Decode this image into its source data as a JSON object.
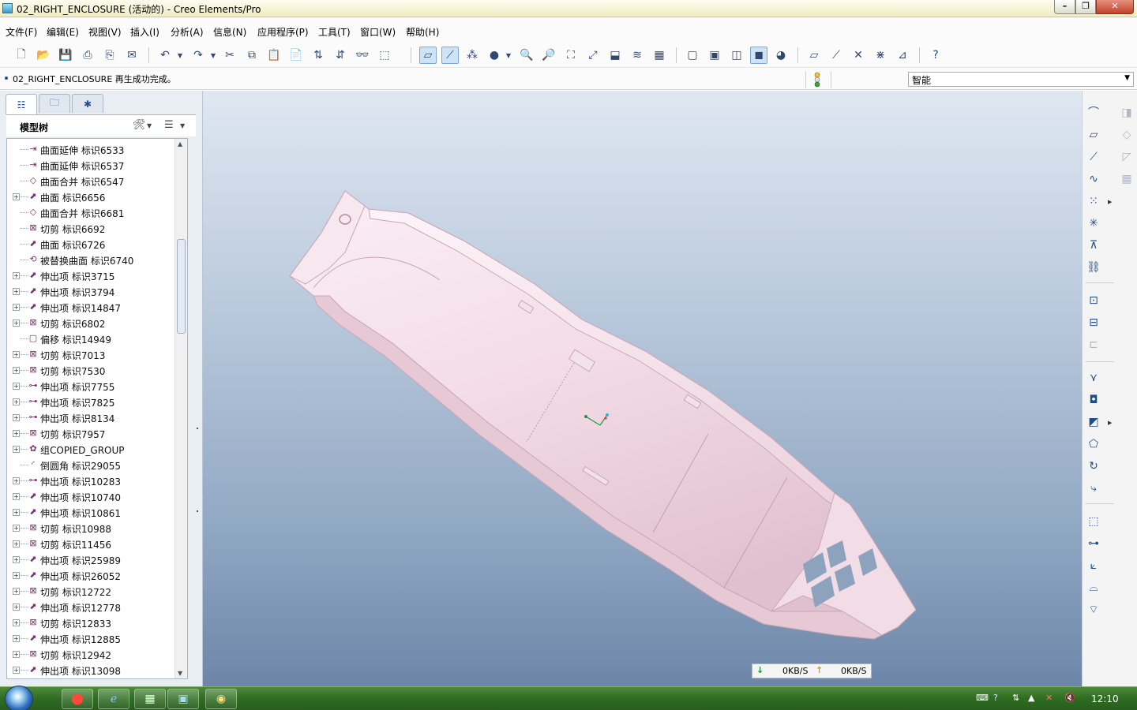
{
  "window": {
    "title": "02_RIGHT_ENCLOSURE (活动的) - Creo Elements/Pro",
    "min": "–",
    "max": "❐",
    "close": "✕"
  },
  "menu": [
    "文件(F)",
    "编辑(E)",
    "视图(V)",
    "插入(I)",
    "分析(A)",
    "信息(N)",
    "应用程序(P)",
    "工具(T)",
    "窗口(W)",
    "帮助(H)"
  ],
  "message": "02_RIGHT_ENCLOSURE 再生成功完成。",
  "filter": {
    "value": "智能"
  },
  "tree": {
    "header": "模型树",
    "items": [
      {
        "label": "曲面延伸 标识6533",
        "expand": false,
        "icon": "extend-icon"
      },
      {
        "label": "曲面延伸 标识6537",
        "expand": false,
        "icon": "extend-icon"
      },
      {
        "label": "曲面合并 标识6547",
        "expand": false,
        "icon": "merge-icon"
      },
      {
        "label": "曲面 标识6656",
        "expand": true,
        "icon": "surface-icon"
      },
      {
        "label": "曲面合并 标识6681",
        "expand": false,
        "icon": "merge-icon"
      },
      {
        "label": "切剪 标识6692",
        "expand": false,
        "icon": "cut-icon"
      },
      {
        "label": "曲面 标识6726",
        "expand": false,
        "icon": "surface-icon"
      },
      {
        "label": "被替换曲面 标识6740",
        "expand": false,
        "icon": "replace-icon"
      },
      {
        "label": "伸出项 标识3715",
        "expand": true,
        "icon": "protrusion-icon"
      },
      {
        "label": "伸出项 标识3794",
        "expand": true,
        "icon": "protrusion-icon"
      },
      {
        "label": "伸出项 标识14847",
        "expand": true,
        "icon": "protrusion-icon"
      },
      {
        "label": "切剪 标识6802",
        "expand": true,
        "icon": "cut-icon"
      },
      {
        "label": "偏移 标识14949",
        "expand": false,
        "icon": "offset-icon"
      },
      {
        "label": "切剪 标识7013",
        "expand": true,
        "icon": "cut-icon"
      },
      {
        "label": "切剪 标识7530",
        "expand": true,
        "icon": "cut-icon"
      },
      {
        "label": "伸出项 标识7755",
        "expand": true,
        "icon": "revolve-icon"
      },
      {
        "label": "伸出项 标识7825",
        "expand": true,
        "icon": "revolve-icon"
      },
      {
        "label": "伸出项 标识8134",
        "expand": true,
        "icon": "revolve-icon"
      },
      {
        "label": "切剪 标识7957",
        "expand": true,
        "icon": "cut-icon"
      },
      {
        "label": "组COPIED_GROUP",
        "expand": true,
        "icon": "group-icon"
      },
      {
        "label": "倒圆角 标识29055",
        "expand": false,
        "icon": "round-icon"
      },
      {
        "label": "伸出项 标识10283",
        "expand": true,
        "icon": "revolve-icon"
      },
      {
        "label": "伸出项 标识10740",
        "expand": true,
        "icon": "protrusion-icon"
      },
      {
        "label": "伸出项 标识10861",
        "expand": true,
        "icon": "protrusion-icon"
      },
      {
        "label": "切剪 标识10988",
        "expand": true,
        "icon": "cut-icon"
      },
      {
        "label": "切剪 标识11456",
        "expand": true,
        "icon": "cut-icon"
      },
      {
        "label": "伸出项 标识25989",
        "expand": true,
        "icon": "protrusion-icon"
      },
      {
        "label": "伸出项 标识26052",
        "expand": true,
        "icon": "protrusion-icon"
      },
      {
        "label": "切剪 标识12722",
        "expand": true,
        "icon": "cut-icon"
      },
      {
        "label": "伸出项 标识12778",
        "expand": true,
        "icon": "protrusion-icon"
      },
      {
        "label": "切剪 标识12833",
        "expand": true,
        "icon": "cut-icon"
      },
      {
        "label": "伸出项 标识12885",
        "expand": true,
        "icon": "protrusion-icon"
      },
      {
        "label": "切剪 标识12942",
        "expand": true,
        "icon": "cut-icon"
      },
      {
        "label": "伸出项 标识13098",
        "expand": true,
        "icon": "protrusion-icon"
      }
    ]
  },
  "speed": {
    "download": "0KB/S",
    "upload": "0KB/S"
  },
  "clock": "12:10"
}
